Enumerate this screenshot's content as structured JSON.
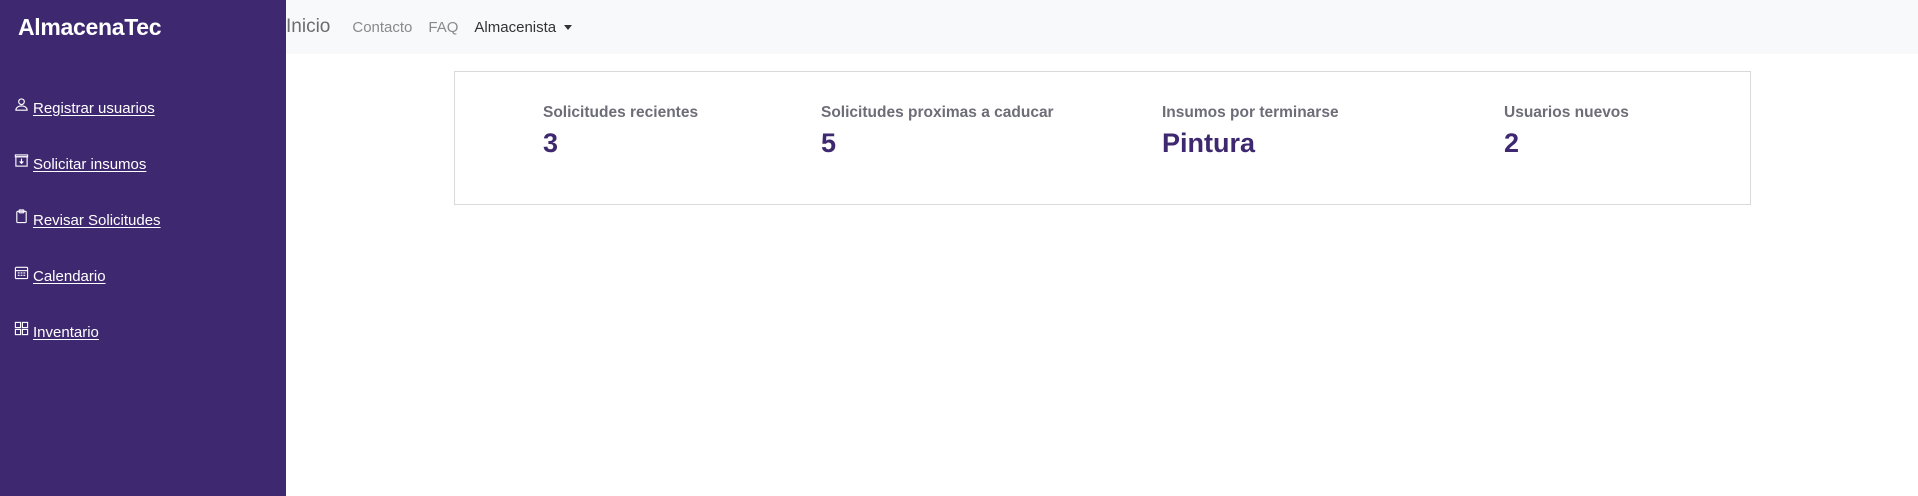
{
  "sidebar": {
    "brand": "AlmacenaTec",
    "items": [
      {
        "label": " Registrar usuarios",
        "icon": "person-icon"
      },
      {
        "label": " Solicitar insumos",
        "icon": "box-arrow-down-icon"
      },
      {
        "label": " Revisar Solicitudes",
        "icon": "clipboard-icon"
      },
      {
        "label": " Calendario",
        "icon": "calendar-icon"
      },
      {
        "label": " Inventario",
        "icon": "grid-icon"
      }
    ]
  },
  "topbar": {
    "home": "Inicio",
    "links": [
      "Contacto",
      "FAQ"
    ],
    "dropdown": "Almacenista"
  },
  "stats": [
    {
      "label": "Solicitudes recientes",
      "value": "3"
    },
    {
      "label": "Solicitudes proximas a caducar",
      "value": "5"
    },
    {
      "label": "Insumos por terminarse",
      "value": "Pintura"
    },
    {
      "label": "Usuarios nuevos",
      "value": "2"
    }
  ],
  "colors": {
    "sidebar_bg": "#3e2870",
    "accent": "#3e2870",
    "topbar_bg": "#f8f9fa"
  }
}
